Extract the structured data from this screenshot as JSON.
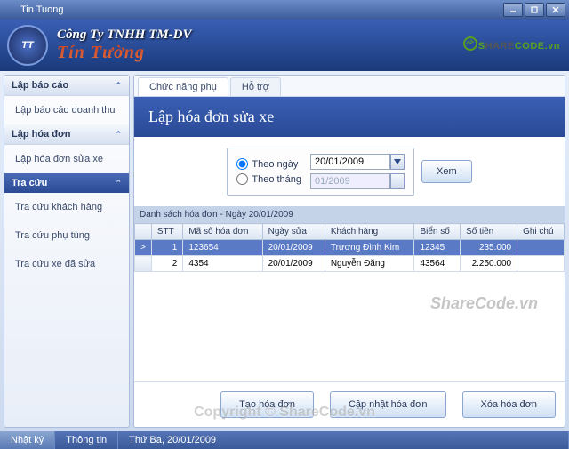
{
  "window": {
    "title": "Tin Tuong"
  },
  "header": {
    "logo_text": "TT",
    "company_line1": "Công Ty TNHH  TM-DV",
    "company_line2": "Tín Tường"
  },
  "watermark": {
    "brand_s": "S",
    "brand_hare": "HARE",
    "brand_code": "CODE",
    "brand_dv": ".vn",
    "grid": "ShareCode.vn",
    "copyright": "Copyright © ShareCode.vn"
  },
  "sidebar": {
    "groups": [
      {
        "title": "Lập báo cáo",
        "items": [
          "Lập báo cáo doanh thu"
        ]
      },
      {
        "title": "Lập hóa đơn",
        "items": [
          "Lập hóa đơn sửa xe"
        ]
      },
      {
        "title": "Tra cứu",
        "active": true,
        "items": [
          "Tra cứu khách hàng",
          "Tra cứu phụ tùng",
          "Tra cứu xe đã sửa"
        ]
      }
    ]
  },
  "tabs": {
    "items": [
      "Chức năng phụ",
      "Hỗ trợ"
    ],
    "active": 0
  },
  "page": {
    "title": "Lập hóa đơn sửa xe"
  },
  "filter": {
    "by_day_label": "Theo ngày",
    "by_month_label": "Theo tháng",
    "date_value": "20/01/2009",
    "month_value": "01/2009",
    "view_btn": "Xem",
    "selected": "day"
  },
  "list": {
    "caption": "Danh sách hóa đơn - Ngày 20/01/2009",
    "columns": [
      "STT",
      "Mã số hóa đơn",
      "Ngày sửa",
      "Khách hàng",
      "Biển số",
      "Số tiền",
      "Ghi chú"
    ],
    "rows": [
      {
        "selected": true,
        "marker": ">",
        "stt": "1",
        "ma": "123654",
        "ngay": "20/01/2009",
        "kh": "Trương Đình Kim",
        "bien": "12345",
        "tien": "235.000",
        "ghi": ""
      },
      {
        "selected": false,
        "marker": "",
        "stt": "2",
        "ma": "4354",
        "ngay": "20/01/2009",
        "kh": "Nguyễn Đăng",
        "bien": "43564",
        "tien": "2.250.000",
        "ghi": ""
      }
    ]
  },
  "actions": {
    "create": "Tạo hóa đơn",
    "update": "Cập nhật hóa đơn",
    "delete": "Xóa hóa đơn"
  },
  "status": {
    "log": "Nhật ký",
    "info": "Thông tin",
    "date": "Thứ Ba, 20/01/2009"
  }
}
